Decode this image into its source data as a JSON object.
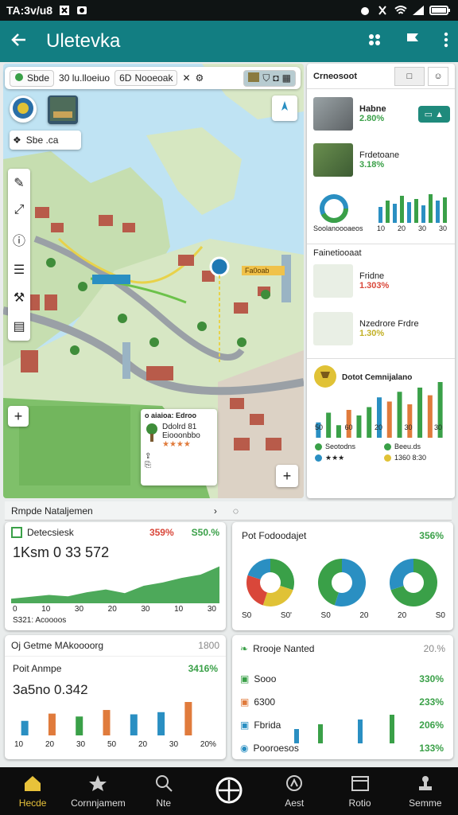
{
  "status_bar": {
    "time": "TA:3v/u8"
  },
  "app_bar": {
    "title": "Uletevka"
  },
  "search_bar": {
    "chip1_text": "Sbde",
    "query": "30 lu.lloeiuo",
    "chip2_prefix": "6D",
    "chip2_text": "Nooeoak"
  },
  "map": {
    "layer_chip": "Sbe .ca",
    "marker_label": "Fa0oab",
    "popup": {
      "title": "o aiaioa: Edroo",
      "line1": "Ddolrd 81",
      "line2": "Eiooonbbo",
      "rating": "★★★★"
    }
  },
  "right_panel": {
    "header": "Crneosoot",
    "items": [
      {
        "name": "Habne",
        "pct": "2.80%"
      },
      {
        "name": "Frdetoane",
        "pct": "3.18%"
      }
    ],
    "mini_chart_label": "Soolanoooaeos",
    "mini_chart_ticks": [
      "10",
      "20",
      "30",
      "30"
    ],
    "section2_title": "Fainetiooaat",
    "items2": [
      {
        "name": "Fridne",
        "pct": "1.303%"
      },
      {
        "name": "Nzedrore Frdre",
        "pct": "1.30%"
      }
    ],
    "chart_title": "Dotot Cemnijalano",
    "chart_ticks": [
      "50",
      "60",
      "20",
      "30",
      "30"
    ],
    "legend": [
      {
        "label": "Seotodns",
        "color": "#3aa048"
      },
      {
        "label": "Beeu.ds",
        "color": "#3aa048"
      },
      {
        "label": "★★★",
        "color": "#2a8fc2"
      },
      {
        "label": "1360 8:30",
        "color": "#e0c236"
      }
    ]
  },
  "section_bar": {
    "title": "Rmpde Nataljemen"
  },
  "panel_left_top": {
    "title": "Detecsiesk",
    "pct_red": "359%",
    "pct_green": "S50.%",
    "big_value": "1Ksm 0 33 572",
    "ticks": [
      "0",
      "10",
      "30",
      "20",
      "30",
      "10",
      "30"
    ],
    "footer": "S321: Acoooos"
  },
  "panel_right_top": {
    "title": "Pot Fodoodajet",
    "pct": "356%",
    "ticks": [
      "S0",
      "S0'",
      "S0",
      "20",
      "20",
      "S0"
    ]
  },
  "panel_left_bottom": {
    "header": "Oj Getme MAkoooorg",
    "header_right": "1800",
    "title": "Poit Anmpe",
    "pct": "3416%",
    "big_value": "3a5no 0.342",
    "ticks": [
      "10",
      "20",
      "30",
      "50",
      "20",
      "30",
      "20%"
    ]
  },
  "panel_right_bottom": {
    "title": "Rrooje Nanted",
    "header_pct": "20.%",
    "rows": [
      {
        "label": "Sooo",
        "pct": "330%"
      },
      {
        "label": "6300",
        "pct": "233%"
      },
      {
        "label": "Fbrida",
        "pct": "206%"
      },
      {
        "label": "Pooroesos",
        "pct": "133%"
      }
    ]
  },
  "chart_data": [
    {
      "type": "bar",
      "title": "",
      "categories": [
        "1",
        "2",
        "3",
        "4",
        "5",
        "6",
        "7",
        "8",
        "9",
        "10",
        "11",
        "12",
        "13"
      ],
      "series": [
        {
          "values": [
            22,
            36,
            18,
            40,
            32,
            44,
            58,
            52,
            66,
            48,
            72,
            61,
            80
          ]
        }
      ],
      "colors": [
        "#2a8fc2",
        "#3aa048",
        "#3aa048",
        "#e07b3c",
        "#3aa048",
        "#3aa048",
        "#2a8fc2",
        "#e07b3c",
        "#3aa048",
        "#e07b3c",
        "#3aa048",
        "#e07b3c",
        "#3aa048"
      ]
    },
    {
      "type": "area",
      "title": "",
      "x": [
        0,
        1,
        2,
        3,
        4,
        5,
        6,
        7,
        8,
        9,
        10,
        11
      ],
      "series": [
        {
          "values": [
            10,
            14,
            18,
            15,
            24,
            30,
            22,
            38,
            45,
            55,
            62,
            80
          ]
        }
      ],
      "ylim": [
        0,
        100
      ]
    },
    {
      "type": "pie",
      "title": "",
      "charts": [
        {
          "values": [
            30,
            25,
            25,
            20
          ],
          "colors": [
            "#3aa048",
            "#e0c236",
            "#d9473a",
            "#2a8fc2"
          ]
        },
        {
          "values": [
            55,
            45
          ],
          "colors": [
            "#2a8fc2",
            "#3aa048"
          ]
        },
        {
          "values": [
            70,
            30
          ],
          "colors": [
            "#3aa048",
            "#2a8fc2"
          ]
        }
      ]
    },
    {
      "type": "bar",
      "title": "",
      "categories": [
        "1",
        "2",
        "3",
        "4",
        "5",
        "6",
        "7"
      ],
      "series": [
        {
          "values": [
            40,
            60,
            52,
            70,
            58,
            64,
            92
          ]
        }
      ],
      "colors": [
        "#2a8fc2",
        "#e07b3c",
        "#3aa048",
        "#e07b3c",
        "#2a8fc2",
        "#2a8fc2",
        "#e07b3c"
      ]
    }
  ]
}
